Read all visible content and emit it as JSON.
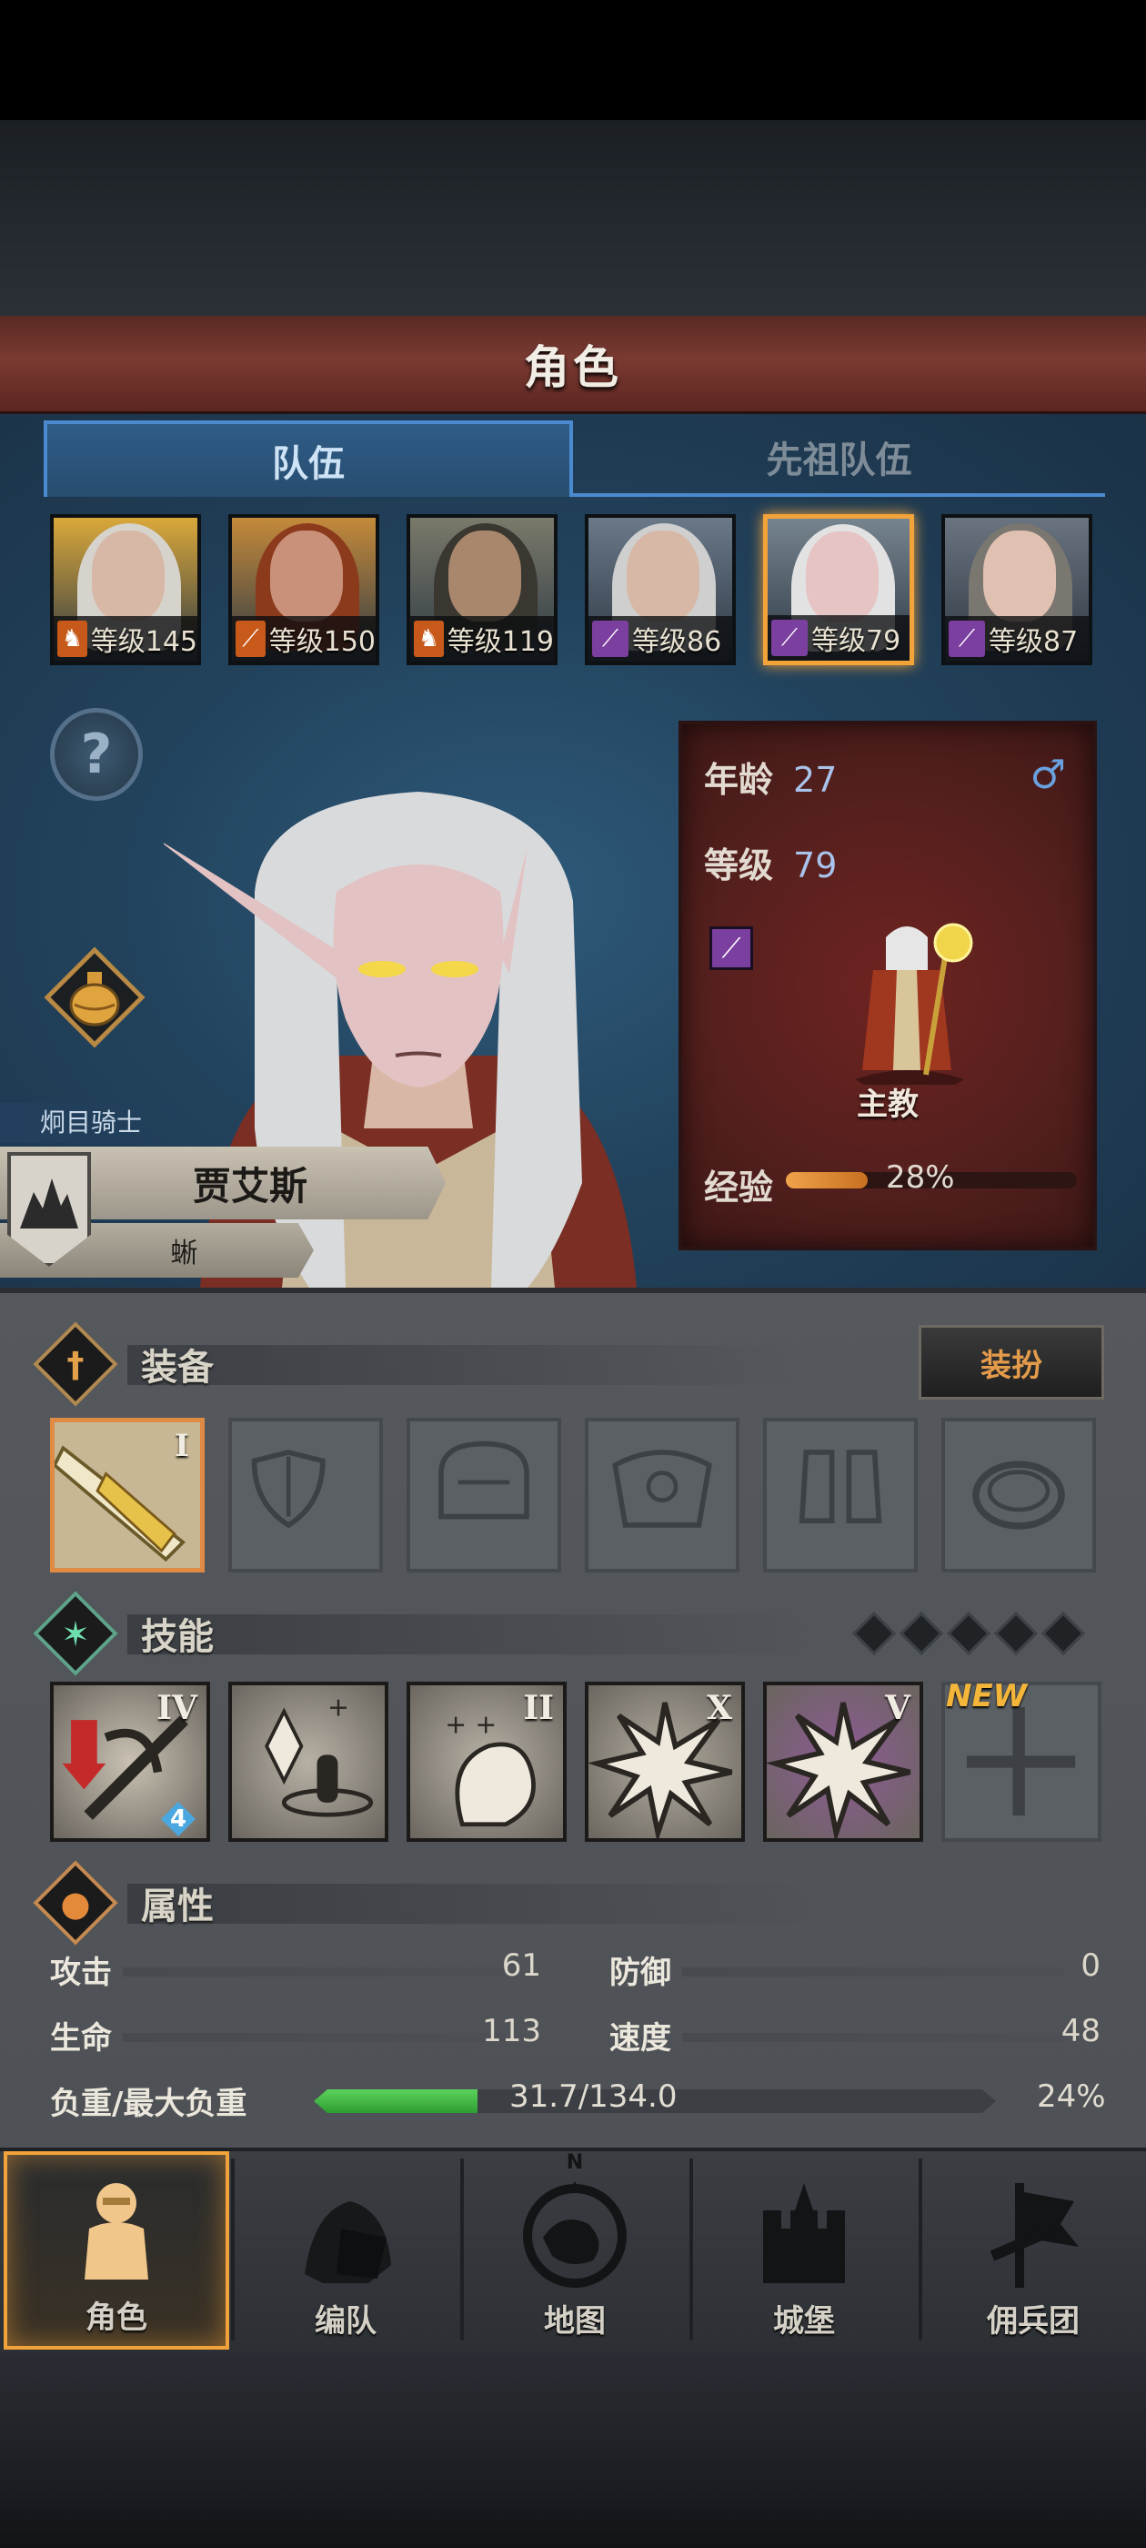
{
  "title": "角色",
  "tabs": {
    "team": "队伍",
    "ancestor": "先祖队伍"
  },
  "roster": [
    {
      "level_label": "等级145",
      "class_icon": "horse-icon",
      "hair": "#d6d3cc",
      "skin": "#d7b8a6",
      "cls_bg": "#c75a1a",
      "bg": "#d9a83a"
    },
    {
      "level_label": "等级150",
      "class_icon": "sword-icon",
      "hair": "#8c3a1c",
      "skin": "#c9917a",
      "cls_bg": "#c75a1a",
      "bg": "#c48a3a"
    },
    {
      "level_label": "等级119",
      "class_icon": "horse-icon",
      "hair": "#3a3630",
      "skin": "#a9876c",
      "cls_bg": "#c75a1a",
      "bg": "#7a7a6a"
    },
    {
      "level_label": "等级86",
      "class_icon": "staff-icon",
      "hair": "#cfcfcf",
      "skin": "#d7b8a6",
      "cls_bg": "#7b3fa0",
      "bg": "#6a7888"
    },
    {
      "level_label": "等级79",
      "class_icon": "staff-icon",
      "hair": "#e2e2e2",
      "skin": "#e6c4c4",
      "cls_bg": "#7b3fa0",
      "bg": "#76848f",
      "selected": true
    },
    {
      "level_label": "等级87",
      "class_icon": "staff-icon",
      "hair": "#7a7670",
      "skin": "#e0c0b0",
      "cls_bg": "#7b3fa0",
      "bg": "#6a7480"
    }
  ],
  "character": {
    "rank": "炯目骑士",
    "name": "贾艾斯",
    "race": "蜥",
    "age_label": "年龄",
    "age": "27",
    "level_label": "等级",
    "level": "79",
    "gender_icon": "♂",
    "job": "主教",
    "xp_label": "经验",
    "xp_text": "28%",
    "xp_fraction": 0.28
  },
  "equipment": {
    "title": "装备",
    "dress_button": "装扮",
    "slots": [
      {
        "name": "weapon-slot",
        "icon": "staff-weapon-icon",
        "roman": "I",
        "filled": true
      },
      {
        "name": "shield-slot",
        "icon": "shield-icon",
        "roman": "",
        "filled": false
      },
      {
        "name": "helmet-slot",
        "icon": "helmet-icon",
        "roman": "",
        "filled": false
      },
      {
        "name": "armor-slot",
        "icon": "armor-icon",
        "roman": "",
        "filled": false
      },
      {
        "name": "boots-slot",
        "icon": "boots-icon",
        "roman": "",
        "filled": false
      },
      {
        "name": "ring-slot",
        "icon": "ring-icon",
        "roman": "",
        "filled": false
      }
    ]
  },
  "skills": {
    "title": "技能",
    "new_tag": "NEW",
    "gem_count": 5,
    "items": [
      {
        "icon": "sword-debuff-icon",
        "roman": "IV",
        "badge": "4",
        "bg": "#c9c2b3"
      },
      {
        "icon": "crystal-heal-icon",
        "roman": "",
        "bg": "#b7b1a5"
      },
      {
        "icon": "arm-buff-icon",
        "roman": "II",
        "bg": "#b7b1a5"
      },
      {
        "icon": "burst-icon",
        "roman": "X",
        "bg": "#b3ada0"
      },
      {
        "icon": "burst-icon",
        "roman": "V",
        "bg": "#8e5a96"
      },
      {
        "icon": "cross-icon",
        "roman": "",
        "empty": true
      }
    ]
  },
  "attributes": {
    "title": "属性",
    "attack_label": "攻击",
    "attack": "61",
    "defense_label": "防御",
    "defense": "0",
    "hp_label": "生命",
    "hp": "113",
    "speed_label": "速度",
    "speed": "48",
    "weight_label": "负重/最大负重",
    "weight_text": "31.7/134.0",
    "weight_pct": "24%",
    "weight_fraction": 0.24
  },
  "nav": [
    {
      "label": "角色",
      "icon": "knight-icon",
      "active": true
    },
    {
      "label": "编队",
      "icon": "helmet-shield-icon"
    },
    {
      "label": "地图",
      "icon": "compass-icon",
      "compass_letter": "N"
    },
    {
      "label": "城堡",
      "icon": "castle-icon"
    },
    {
      "label": "佣兵团",
      "icon": "banner-icon"
    }
  ],
  "colors": {
    "accent": "#f2a23a",
    "title_bar": "#7a3a32",
    "tab_blue": "#4c8ad0",
    "info_card": "#6e2320"
  }
}
